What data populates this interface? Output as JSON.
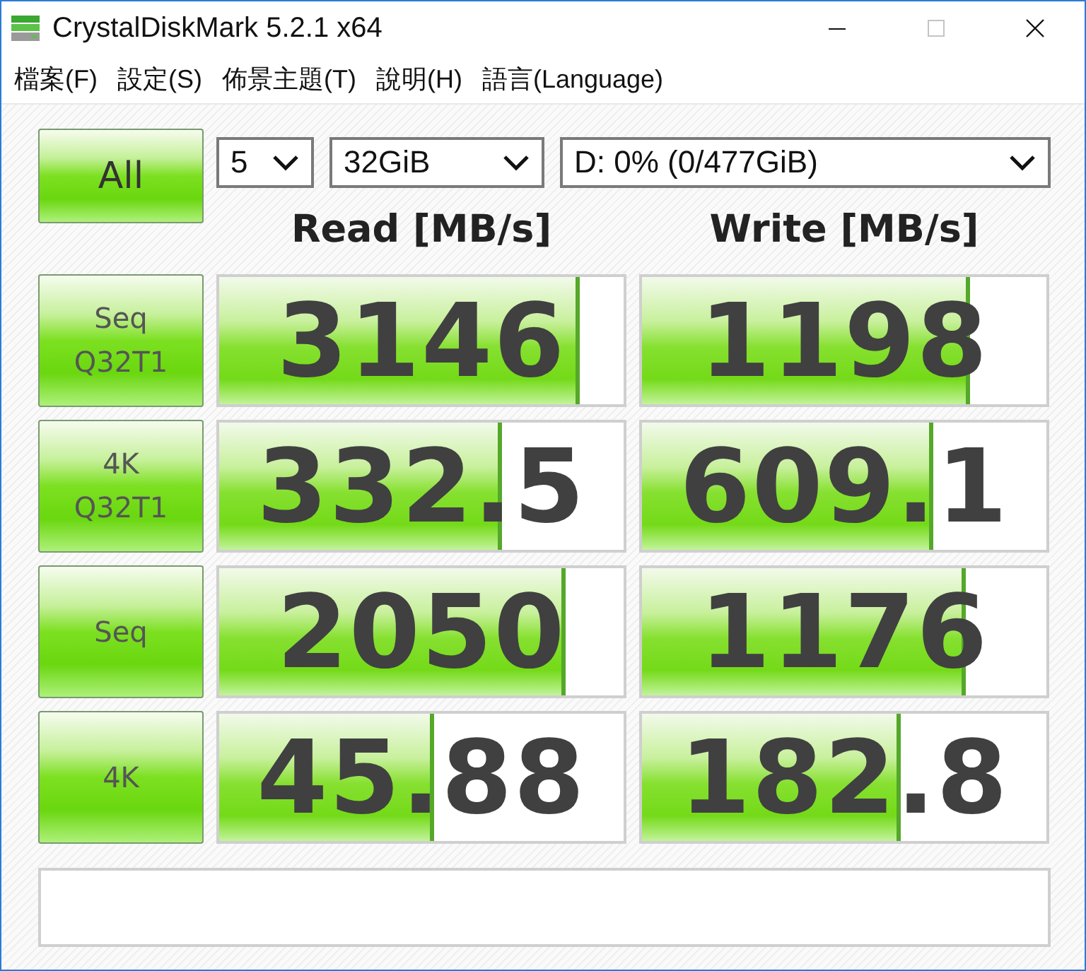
{
  "window": {
    "title": "CrystalDiskMark 5.2.1 x64"
  },
  "menu": [
    "檔案(F)",
    "設定(S)",
    "佈景主題(T)",
    "說明(H)",
    "語言(Language)"
  ],
  "all_button": {
    "label": "All"
  },
  "selects": [
    {
      "value": "5"
    },
    {
      "value": "32GiB"
    },
    {
      "value": "D: 0% (0/477GiB)"
    }
  ],
  "headers": [
    "Read [MB/s]",
    "Write [MB/s]"
  ],
  "rows": [
    {
      "label": "Seq\nQ32T1",
      "read": {
        "value": "3146",
        "level": 0.89
      },
      "write": {
        "value": "1198",
        "level": 0.81
      }
    },
    {
      "label": "4K\nQ32T1",
      "read": {
        "value": "332.5",
        "level": 0.7
      },
      "write": {
        "value": "609.1",
        "level": 0.72
      }
    },
    {
      "label": "Seq",
      "read": {
        "value": "2050",
        "level": 0.855
      },
      "write": {
        "value": "1176",
        "level": 0.8
      }
    },
    {
      "label": "4K",
      "read": {
        "value": "45.88",
        "level": 0.53
      },
      "write": {
        "value": "182.8",
        "level": 0.64
      }
    }
  ]
}
